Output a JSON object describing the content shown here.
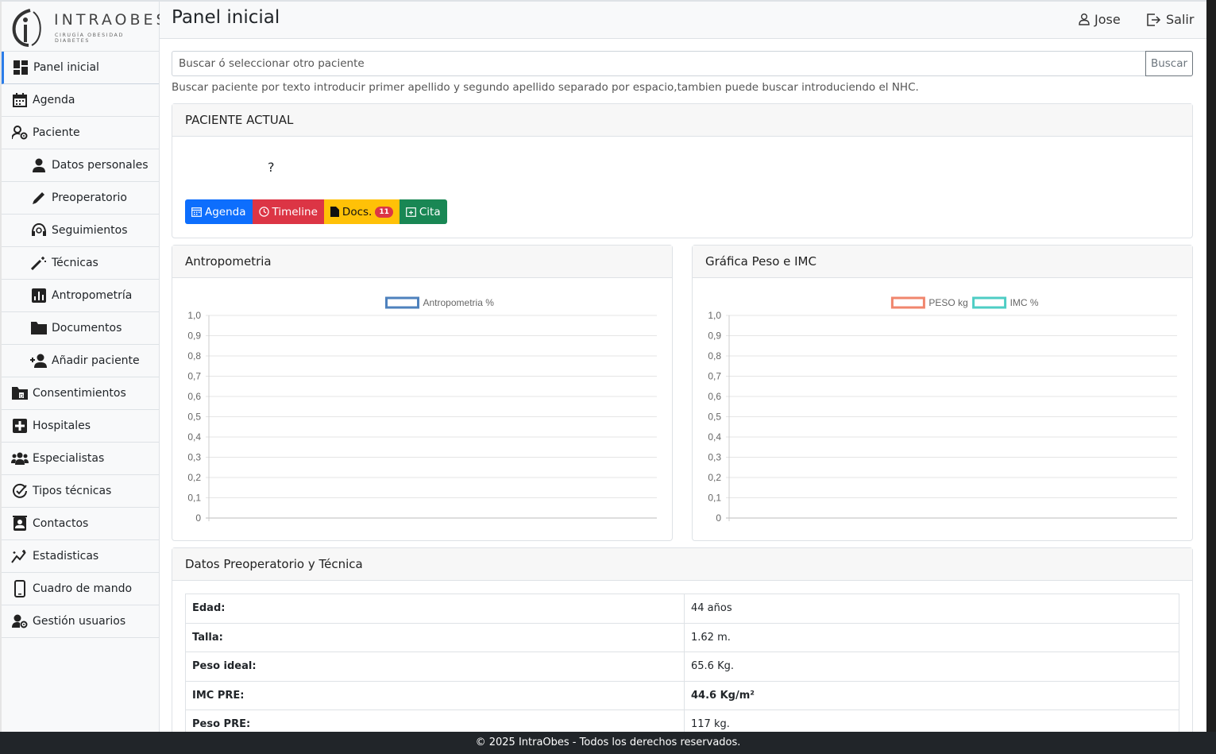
{
  "brand": {
    "name": "INTRAOBES",
    "tagline": "CIRUGÍA OBESIDAD DIABETES"
  },
  "sidebar": {
    "items": [
      {
        "label": "Panel inicial",
        "icon": "dashboard-icon"
      },
      {
        "label": "Agenda",
        "icon": "calendar-icon"
      },
      {
        "label": "Paciente",
        "icon": "user-gear-icon"
      },
      {
        "label": "Datos personales",
        "icon": "person-icon"
      },
      {
        "label": "Preoperatorio",
        "icon": "pencil-icon"
      },
      {
        "label": "Seguimientos",
        "icon": "headset-icon"
      },
      {
        "label": "Técnicas",
        "icon": "magic-wand-icon"
      },
      {
        "label": "Antropometría",
        "icon": "bar-chart-icon"
      },
      {
        "label": "Documentos",
        "icon": "folder-icon"
      },
      {
        "label": "Añadir paciente",
        "icon": "person-add-icon"
      },
      {
        "label": "Consentimientos",
        "icon": "folder-document-icon"
      },
      {
        "label": "Hospitales",
        "icon": "hospital-plus-icon"
      },
      {
        "label": "Especialistas",
        "icon": "people-icon"
      },
      {
        "label": "Tipos técnicas",
        "icon": "check-circle-icon"
      },
      {
        "label": "Contactos",
        "icon": "contact-card-icon"
      },
      {
        "label": "Estadisticas",
        "icon": "sparkle-chart-icon"
      },
      {
        "label": "Cuadro de mando",
        "icon": "phone-icon"
      },
      {
        "label": "Gestión usuarios",
        "icon": "user-gear-icon"
      }
    ]
  },
  "header": {
    "title": "Panel inicial",
    "user": "Jose",
    "logout": "Salir"
  },
  "search": {
    "placeholder": "Buscar ó seleccionar otro paciente",
    "button": "Buscar",
    "help": "Buscar paciente por texto introducir primer apellido y segundo apellido separado por espacio,tambien puede buscar introduciendo el NHC."
  },
  "patient_card": {
    "title": "PACIENTE ACTUAL",
    "name": "?",
    "buttons": {
      "agenda": "Agenda",
      "timeline": "Timeline",
      "docs": "Docs.",
      "docs_count": "11",
      "cita": "Cita"
    }
  },
  "chart_data": [
    {
      "card_title": "Antropometria",
      "type": "line",
      "series": [
        {
          "name": "Antropometria %",
          "values": [],
          "color": "#4e81bd"
        }
      ],
      "ylim": [
        0,
        1
      ],
      "yticks": [
        "0",
        "0,1",
        "0,2",
        "0,3",
        "0,4",
        "0,5",
        "0,6",
        "0,7",
        "0,8",
        "0,9",
        "1,0"
      ],
      "legend": "top"
    },
    {
      "card_title": "Gráfica Peso e IMC",
      "type": "line",
      "series": [
        {
          "name": "PESO kg",
          "values": [],
          "color": "#f0866d"
        },
        {
          "name": "IMC %",
          "values": [],
          "color": "#4ecdc4"
        }
      ],
      "ylim": [
        0,
        1
      ],
      "yticks": [
        "0",
        "0,1",
        "0,2",
        "0,3",
        "0,4",
        "0,5",
        "0,6",
        "0,7",
        "0,8",
        "0,9",
        "1,0"
      ],
      "legend": "top"
    }
  ],
  "preop": {
    "title": "Datos Preoperatorio y Técnica",
    "rows": [
      {
        "k": "Edad:",
        "v": "44 años"
      },
      {
        "k": "Talla:",
        "v": "1.62 m."
      },
      {
        "k": "Peso ideal:",
        "v": "65.6 Kg."
      },
      {
        "k": "IMC PRE:",
        "v": "44.6 Kg/m²"
      },
      {
        "k": "Peso PRE:",
        "v": "117 kg."
      }
    ]
  },
  "footer": "© 2025 IntraObes - Todos los derechos reservados."
}
